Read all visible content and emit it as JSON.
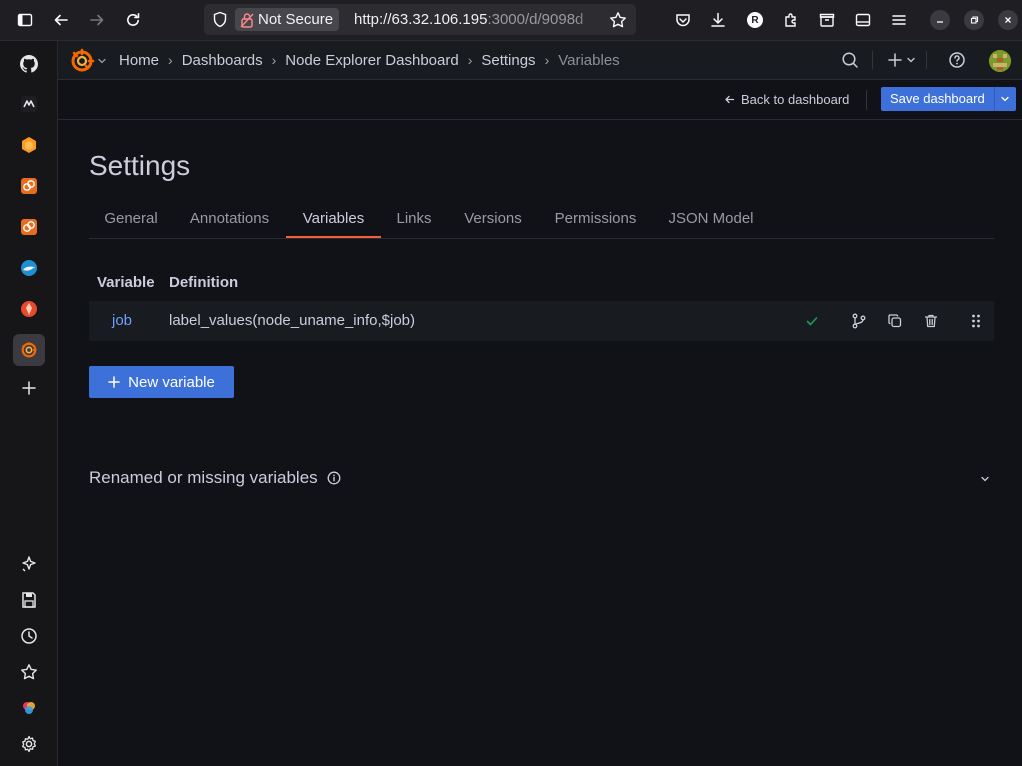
{
  "browser": {
    "not_secure_label": "Not Secure",
    "url_host": "http://63.32.106.195",
    "url_rest": ":3000/d/9098d",
    "profile_initial": "R"
  },
  "dock": {
    "items": [
      "github-icon",
      "app-icon",
      "app-icon",
      "app-icon",
      "app-icon",
      "app-icon",
      "app-icon",
      "grafana-icon",
      "add-icon",
      "sparkle-icon",
      "floppy-icon",
      "clock-icon",
      "star-icon",
      "app-icon",
      "gear-icon"
    ]
  },
  "topnav": {
    "breadcrumbs": [
      "Home",
      "Dashboards",
      "Node Explorer Dashboard",
      "Settings",
      "Variables"
    ]
  },
  "toolbar": {
    "back_label": "Back to dashboard",
    "save_label": "Save dashboard"
  },
  "settings": {
    "title": "Settings",
    "tabs": [
      "General",
      "Annotations",
      "Variables",
      "Links",
      "Versions",
      "Permissions",
      "JSON Model"
    ],
    "active_tab": "Variables"
  },
  "variables": {
    "headers": {
      "variable": "Variable",
      "definition": "Definition"
    },
    "rows": [
      {
        "name": "job",
        "definition": "label_values(node_uname_info,$job)"
      }
    ],
    "new_button": "New variable"
  },
  "missing": {
    "title": "Renamed or missing variables"
  },
  "colors": {
    "accent_blue": "#3d71d9",
    "link_blue": "#6e9fff",
    "active_tab_underline": "#f55f3e",
    "success_green": "#1a9e59",
    "background": "#111217"
  }
}
